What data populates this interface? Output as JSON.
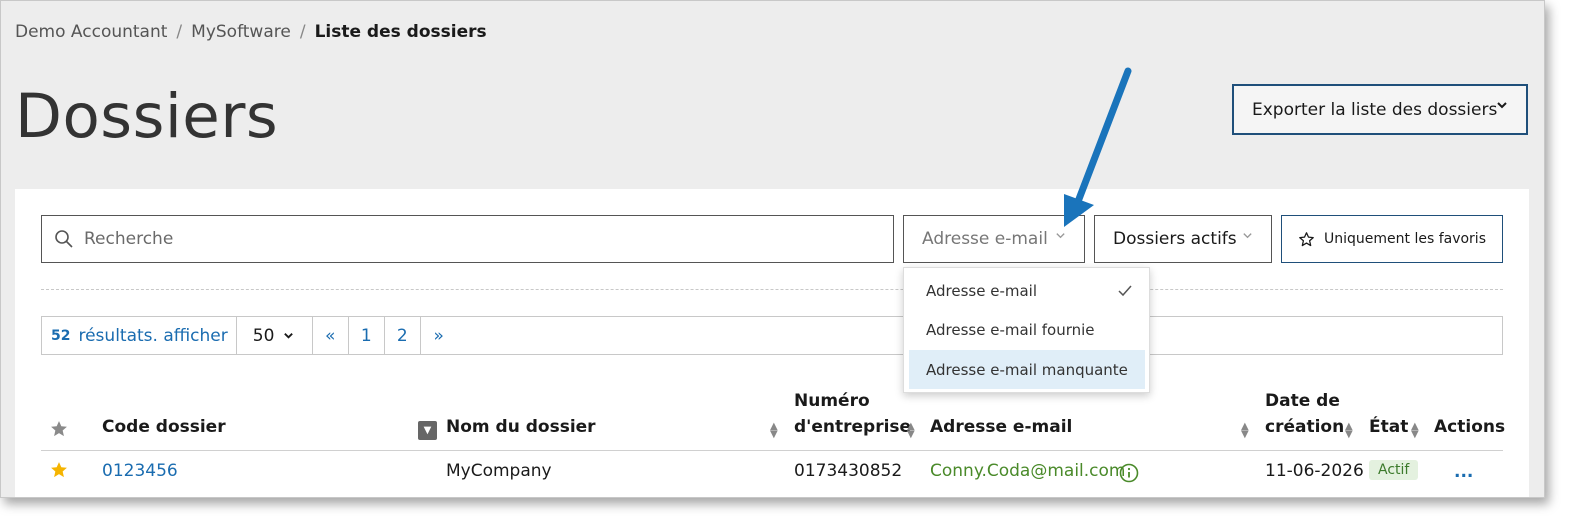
{
  "breadcrumb": {
    "item1": "Demo Accountant",
    "item2": "MySoftware",
    "current": "Liste des dossiers",
    "separator": "/"
  },
  "page": {
    "title": "Dossiers"
  },
  "export": {
    "label": "Exporter la liste des dossiers"
  },
  "search": {
    "placeholder": "Recherche"
  },
  "filters": {
    "email": "Adresse e-mail",
    "status": "Dossiers actifs",
    "favorites": "Uniquement les favoris"
  },
  "dropdown": {
    "options": [
      "Adresse e-mail",
      "Adresse e-mail fournie",
      "Adresse e-mail manquante"
    ],
    "selected_index": 0,
    "highlighted_index": 2
  },
  "pager": {
    "count": "52",
    "text": "résultats. afficher",
    "per_page": "50",
    "first": "«",
    "pages": [
      "1",
      "2"
    ],
    "last": "»"
  },
  "table": {
    "headers": {
      "code": "Code dossier",
      "name": "Nom du dossier",
      "number_line1": "Numéro",
      "number_line2": "d'entreprise",
      "email": "Adresse e-mail",
      "date_line1": "Date de",
      "date_line2": "création",
      "state": "État",
      "actions": "Actions"
    },
    "rows": [
      {
        "favorite": true,
        "code": "0123456",
        "name": "MyCompany",
        "number": "0173430852",
        "email": "Conny.Coda@mail.com",
        "date": "11-06-2026",
        "state": "Actif",
        "actions": "..."
      }
    ]
  },
  "colors": {
    "accent": "#1a6cb0",
    "star": "#f5b400",
    "email_green": "#4a8a2a",
    "arrow": "#1a74bb"
  }
}
